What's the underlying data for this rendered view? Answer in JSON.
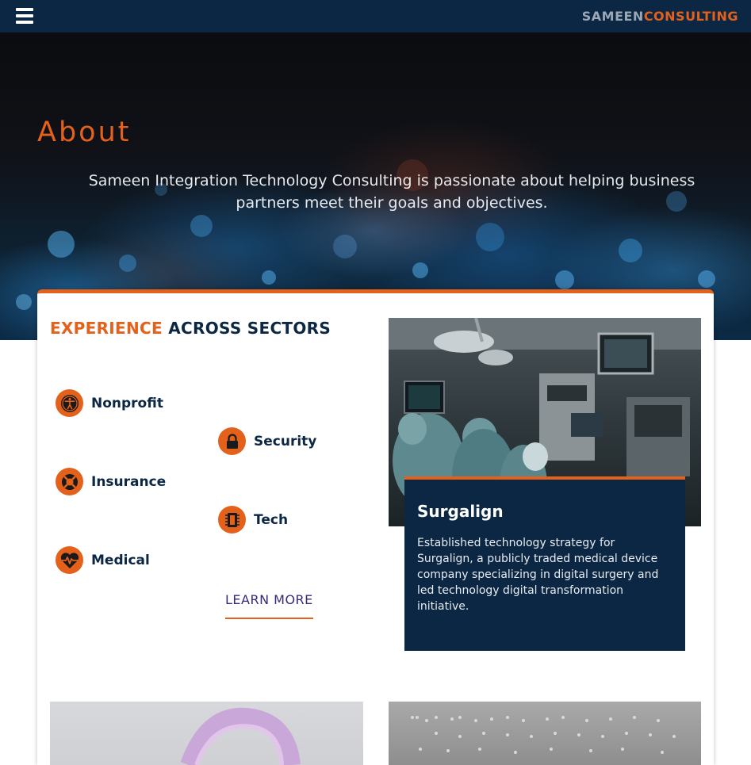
{
  "header": {
    "brand_part1": "SAMEEN",
    "brand_part2": "CONSULTING",
    "menu_icon": "hamburger-menu-icon"
  },
  "hero": {
    "title": "About",
    "text": "Sameen Integration Technology Consulting is passionate about helping business partners meet their goals and objectives."
  },
  "experience": {
    "heading_highlight": "EXPERIENCE",
    "heading_rest": "ACROSS SECTORS",
    "sectors": [
      {
        "label": "Nonprofit",
        "icon": "accessibility-person-icon"
      },
      {
        "label": "Security",
        "icon": "lock-icon"
      },
      {
        "label": "Insurance",
        "icon": "lifebuoy-icon"
      },
      {
        "label": "Tech",
        "icon": "microchip-icon"
      },
      {
        "label": "Medical",
        "icon": "heartbeat-icon"
      }
    ],
    "learn_more": "LEARN MORE"
  },
  "case_study": {
    "title": "Surgalign",
    "description": "Established technology strategy for Surgalign, a publicly traded medical device company specializing in digital surgery and led technology digital transformation initiative."
  },
  "colors": {
    "navy": "#0c2744",
    "orange": "#e4611b",
    "link_purple": "#3a2a7a"
  }
}
